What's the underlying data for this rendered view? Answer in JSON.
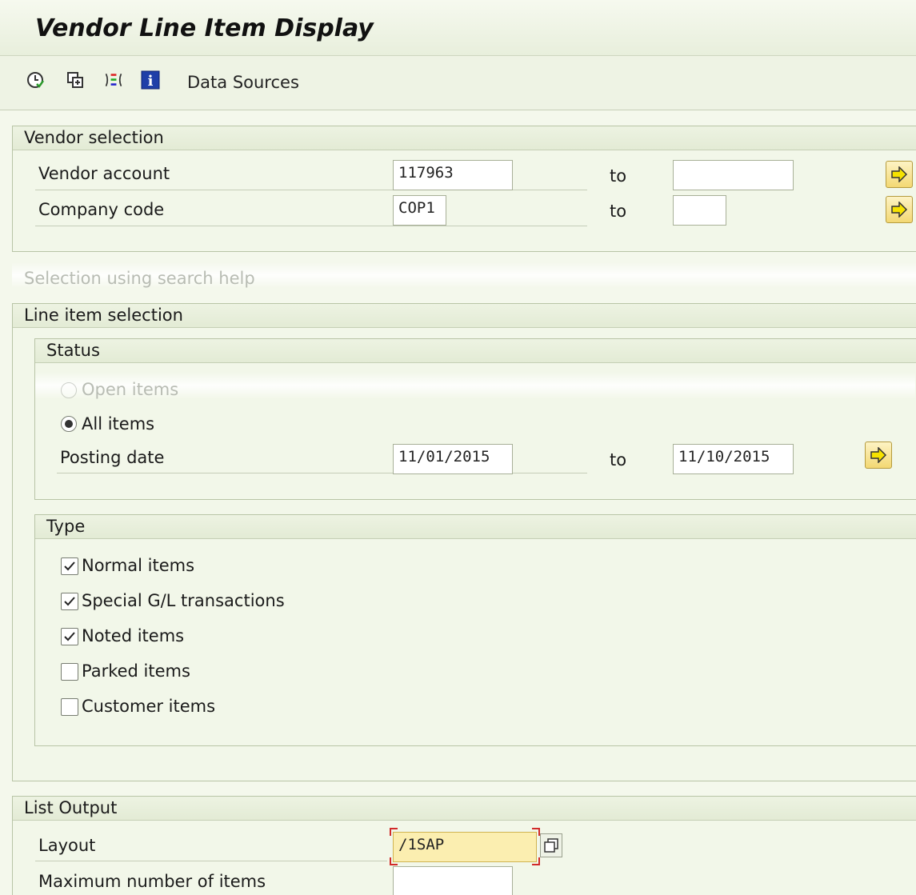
{
  "window": {
    "title": "Vendor Line Item Display"
  },
  "toolbar": {
    "icons": [
      "execute-icon",
      "copy-variant-icon",
      "selection-options-icon",
      "info-icon"
    ],
    "data_sources_label": "Data Sources"
  },
  "vendor_selection": {
    "title": "Vendor selection",
    "rows": [
      {
        "label": "Vendor account",
        "from": "117963",
        "to_label": "to",
        "to": ""
      },
      {
        "label": "Company code",
        "from": "COP1",
        "to_label": "to",
        "to": ""
      }
    ]
  },
  "search_help": {
    "title": "Selection using search help"
  },
  "line_item_selection": {
    "title": "Line item selection",
    "status": {
      "title": "Status",
      "options": [
        {
          "label": "Open items",
          "selected": false
        },
        {
          "label": "All items",
          "selected": true
        }
      ],
      "posting_date": {
        "label": "Posting date",
        "from": "11/01/2015",
        "to_label": "to",
        "to": "11/10/2015"
      }
    },
    "type": {
      "title": "Type",
      "items": [
        {
          "label": "Normal items",
          "checked": true
        },
        {
          "label": "Special G/L transactions",
          "checked": true
        },
        {
          "label": "Noted items",
          "checked": true
        },
        {
          "label": "Parked items",
          "checked": false
        },
        {
          "label": "Customer items",
          "checked": false
        }
      ]
    }
  },
  "list_output": {
    "title": "List Output",
    "layout": {
      "label": "Layout",
      "value": "/1SAP"
    },
    "max_items": {
      "label": "Maximum number of items",
      "value": ""
    }
  }
}
